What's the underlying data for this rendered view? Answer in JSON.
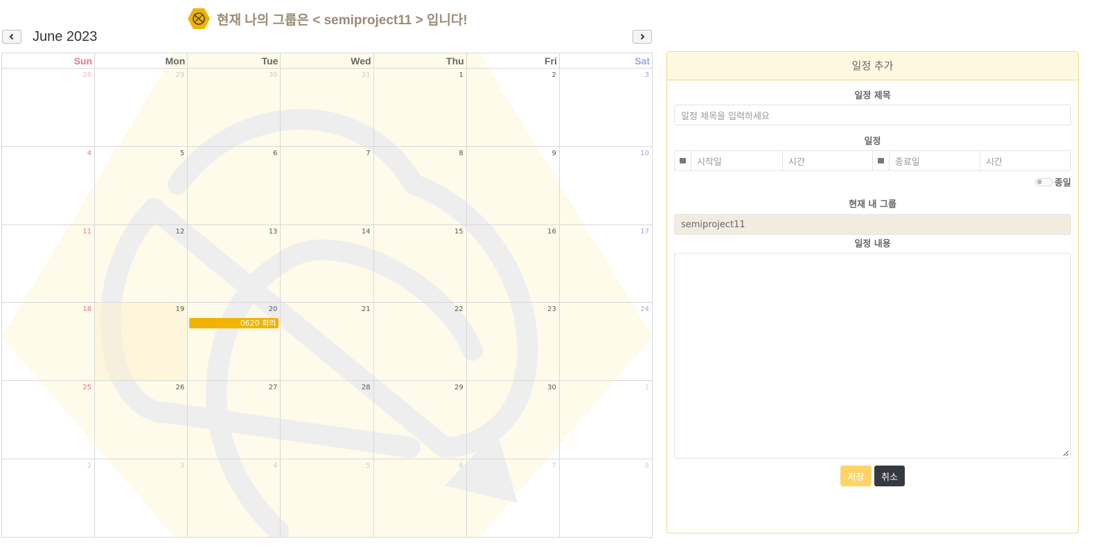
{
  "header": {
    "group_text": "현재 나의 그룹은 < semiproject11 > 입니다!",
    "month_title": "June 2023",
    "prev_icon": "chevron-left-icon",
    "next_icon": "chevron-right-icon"
  },
  "calendar": {
    "weekdays": [
      "Sun",
      "Mon",
      "Tue",
      "Wed",
      "Thu",
      "Fri",
      "Sat"
    ],
    "weeks": [
      [
        "28",
        "29",
        "30",
        "31",
        "1",
        "2",
        "3"
      ],
      [
        "4",
        "5",
        "6",
        "7",
        "8",
        "9",
        "10"
      ],
      [
        "11",
        "12",
        "13",
        "14",
        "15",
        "16",
        "17"
      ],
      [
        "18",
        "19",
        "20",
        "21",
        "22",
        "23",
        "24"
      ],
      [
        "25",
        "26",
        "27",
        "28",
        "29",
        "30",
        "1"
      ],
      [
        "2",
        "3",
        "4",
        "5",
        "6",
        "7",
        "8"
      ]
    ],
    "event": {
      "label": "0620 회의",
      "color": "#f0b400"
    }
  },
  "panel": {
    "header": "일정 추가",
    "title_label": "일정 제목",
    "title_placeholder": "일정 제목을 입력하세요",
    "schedule_label": "일정",
    "start_date_placeholder": "시작일",
    "start_time_placeholder": "시간",
    "end_date_placeholder": "종료일",
    "end_time_placeholder": "시간",
    "allday_label": "종일",
    "group_label": "현재 내 그룹",
    "group_value": "semiproject11",
    "content_label": "일정 내용",
    "save_label": "저장",
    "cancel_label": "취소"
  },
  "colors": {
    "accent": "#f0b400",
    "sunday": "#e8748a",
    "saturday": "#9aa6d6",
    "save_button": "#ffd466",
    "cancel_button": "#343a40"
  }
}
